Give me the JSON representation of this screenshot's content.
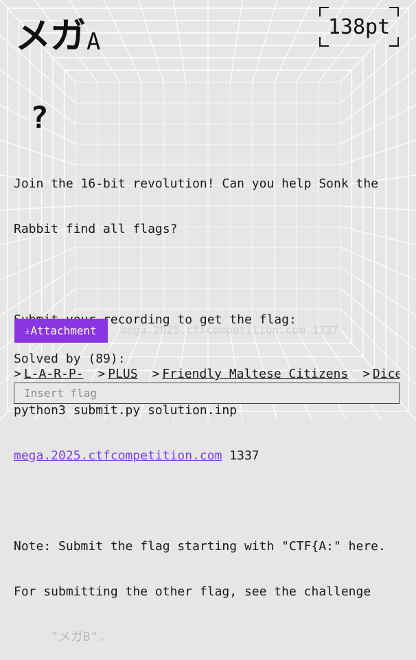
{
  "challenge": {
    "title": "メガ",
    "title_suffix": "A",
    "points": "138pt",
    "icon": "question-mark-icon"
  },
  "description": {
    "line1": "Join the 16-bit revolution! Can you help Sonk the",
    "line2": "Rabbit find all flags?",
    "line3": "Submit your recording to get the flag:",
    "line4": "python3 submit.py solution.inp",
    "link": "mega.2025.ctfcompetition.com",
    "port": " 1337",
    "line6": "Note: Submit the flag starting with \"CTF{A:\" here.",
    "line7": "For submitting the other flag, see the challenge",
    "line8": "     \"メガB\"."
  },
  "attachment": {
    "label": "Attachment",
    "icon": "download-arrow-icon"
  },
  "ghost_text": "mega.2025.ctfcompetition.com 1337",
  "solved": {
    "label": "Solved by (89):",
    "teams": [
      "L-A-R-P-",
      "PLUS",
      "Friendly Maltese Citizens",
      "DiceGang"
    ]
  },
  "flag_input": {
    "placeholder": "Insert flag",
    "value": ""
  },
  "colors": {
    "accent": "#8a35e2",
    "link": "#7a3fe0",
    "background": "#e6e6e6"
  }
}
